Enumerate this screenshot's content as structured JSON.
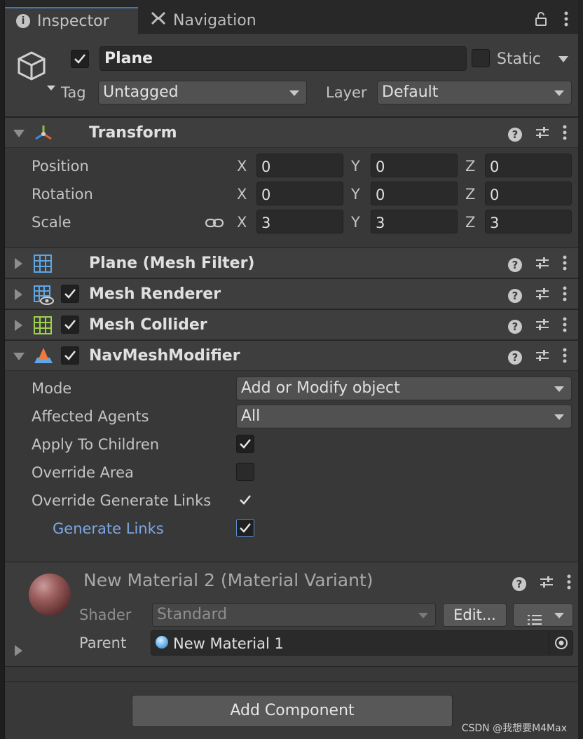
{
  "tabs": {
    "inspector": "Inspector",
    "navigation": "Navigation"
  },
  "header": {
    "active": true,
    "name": "Plane",
    "static_label": "Static",
    "tag_label": "Tag",
    "tag_value": "Untagged",
    "layer_label": "Layer",
    "layer_value": "Default"
  },
  "transform": {
    "title": "Transform",
    "position_label": "Position",
    "rotation_label": "Rotation",
    "scale_label": "Scale",
    "axis_x": "X",
    "axis_y": "Y",
    "axis_z": "Z",
    "position": {
      "x": "0",
      "y": "0",
      "z": "0"
    },
    "rotation": {
      "x": "0",
      "y": "0",
      "z": "0"
    },
    "scale": {
      "x": "3",
      "y": "3",
      "z": "3"
    }
  },
  "components": {
    "mesh_filter": "Plane (Mesh Filter)",
    "mesh_renderer": "Mesh Renderer",
    "mesh_collider": "Mesh Collider",
    "navmesh_modifier": "NavMeshModifier"
  },
  "navmesh": {
    "mode_label": "Mode",
    "mode_value": "Add or Modify object",
    "agents_label": "Affected Agents",
    "agents_value": "All",
    "apply_children_label": "Apply To Children",
    "apply_children": true,
    "override_area_label": "Override Area",
    "override_area": false,
    "override_links_label": "Override Generate Links",
    "override_links": true,
    "generate_links_label": "Generate Links",
    "generate_links": true
  },
  "material": {
    "title": "New Material 2 (Material Variant)",
    "shader_label": "Shader",
    "shader_value": "Standard",
    "edit_label": "Edit...",
    "parent_label": "Parent",
    "parent_value": "New Material 1"
  },
  "add_component_label": "Add Component",
  "watermark": "CSDN @我想要M4Max",
  "colors": {
    "accent_tab": "#3a79bb",
    "link_label": "#7ca8e6",
    "panel_bg": "#383838"
  }
}
